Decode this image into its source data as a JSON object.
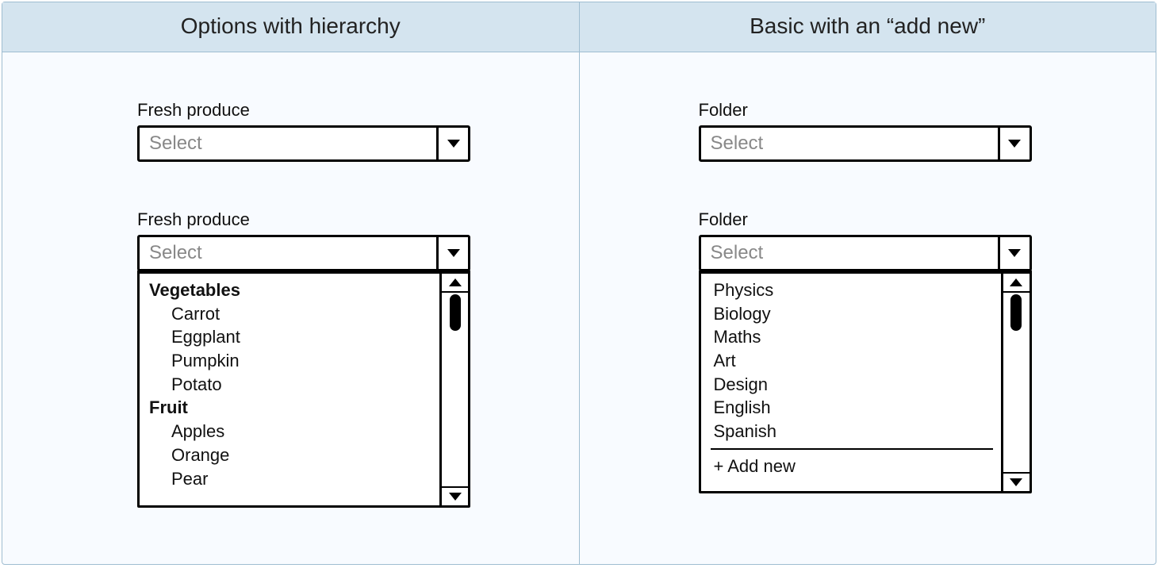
{
  "left": {
    "title": "Options with hierarchy",
    "label": "Fresh produce",
    "placeholder": "Select",
    "groups": [
      {
        "name": "Vegetables",
        "items": [
          "Carrot",
          "Eggplant",
          "Pumpkin",
          "Potato"
        ]
      },
      {
        "name": "Fruit",
        "items": [
          "Apples",
          "Orange",
          "Pear"
        ]
      }
    ]
  },
  "right": {
    "title": "Basic with an “add new”",
    "label": "Folder",
    "placeholder": "Select",
    "options": [
      "Physics",
      "Biology",
      "Maths",
      "Art",
      "Design",
      "English",
      "Spanish"
    ],
    "add_new": "+ Add new"
  }
}
